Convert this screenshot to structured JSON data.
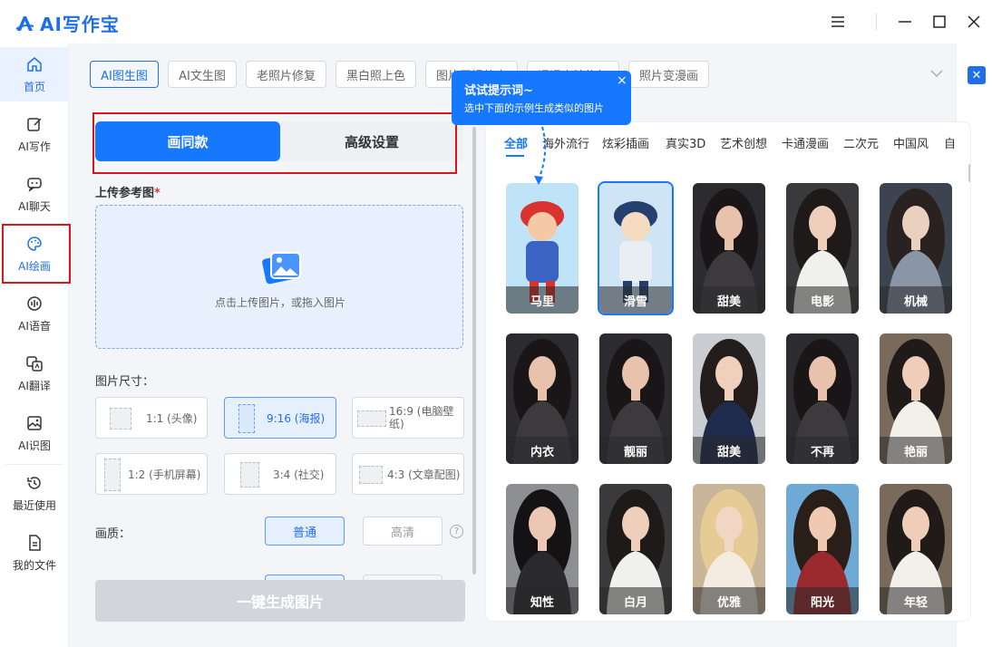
{
  "app": {
    "title": "AI写作宝"
  },
  "colors": {
    "accent": "#1677ff",
    "highlight_box": "#d9161b"
  },
  "sidebar": {
    "items": [
      {
        "label": "首页",
        "icon": "home-icon"
      },
      {
        "label": "AI写作",
        "icon": "edit-icon"
      },
      {
        "label": "AI聊天",
        "icon": "chat-icon"
      },
      {
        "label": "AI绘画",
        "icon": "palette-icon"
      },
      {
        "label": "AI语音",
        "icon": "audio-wave-icon"
      },
      {
        "label": "AI翻译",
        "icon": "translate-icon"
      },
      {
        "label": "AI识图",
        "icon": "image-scan-icon"
      },
      {
        "label": "最近使用",
        "icon": "history-icon"
      },
      {
        "label": "我的文件",
        "icon": "file-icon"
      }
    ]
  },
  "tabs": [
    "AI图生图",
    "AI文生图",
    "老照片修复",
    "黑白照上色",
    "图片无损放大",
    "漫漫人脸修复",
    "照片变漫画"
  ],
  "mode": {
    "primary": "画同款",
    "secondary": "高级设置"
  },
  "upload": {
    "label": "上传参考图",
    "required_mark": "*",
    "hint": "点击上传图片，或拖入图片"
  },
  "size": {
    "label": "图片尺寸：",
    "options": [
      "1:1 (头像)",
      "9:16 (海报)",
      "16:9 (电脑壁纸)",
      "1:2 (手机屏幕)",
      "3:4 (社交)",
      "4:3 (文章配图)"
    ],
    "selected": "9:16 (海报)"
  },
  "quality": {
    "label": "画质：",
    "options": [
      "普通",
      "高清"
    ],
    "selected": "普通",
    "help": "?"
  },
  "generate": {
    "label": "一键生成图片"
  },
  "tooltip": {
    "title": "试试提示词~",
    "body": "选中下面的示例生成类似的图片",
    "close": "×"
  },
  "categories": [
    "全部",
    "海外流行",
    "炫彩插画",
    "真实3D",
    "艺术创想",
    "卡通漫画",
    "二次元",
    "中国风",
    "自"
  ],
  "gallery": [
    {
      "caption": "马里",
      "style": "cartoon-red"
    },
    {
      "caption": "滑雪",
      "style": "cartoon-blue"
    },
    {
      "caption": "甜美",
      "style": "photo"
    },
    {
      "caption": "电影",
      "style": "photo-light"
    },
    {
      "caption": "机械",
      "style": "photo-mech"
    },
    {
      "caption": "内衣",
      "style": "photo"
    },
    {
      "caption": "靓丽",
      "style": "photo"
    },
    {
      "caption": "甜美",
      "style": "photo-navy"
    },
    {
      "caption": "不再",
      "style": "photo"
    },
    {
      "caption": "艳丽",
      "style": "photo-street"
    },
    {
      "caption": "知性",
      "style": "photo-office"
    },
    {
      "caption": "白月",
      "style": "photo-light"
    },
    {
      "caption": "优雅",
      "style": "photo-blonde"
    },
    {
      "caption": "阳光",
      "style": "photo-sea"
    },
    {
      "caption": "年轻",
      "style": "photo-street"
    }
  ]
}
